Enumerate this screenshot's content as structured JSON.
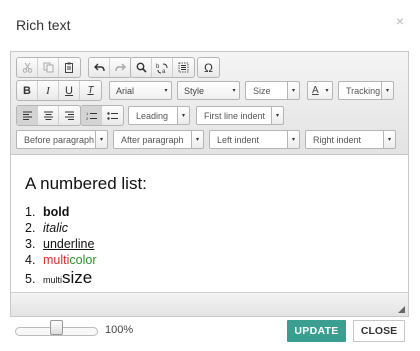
{
  "dialog": {
    "title": "Rich text",
    "close_glyph": "×"
  },
  "toolbar": {
    "font": "Arial",
    "style": "Style",
    "size": "Size",
    "font_color_glyph": "A",
    "tracking": "Tracking",
    "leading": "Leading",
    "first_line_indent": "First line indent",
    "before_paragraph": "Before paragraph",
    "after_paragraph": "After paragraph",
    "left_indent": "Left indent",
    "right_indent": "Right indent",
    "bold_glyph": "B",
    "italic_glyph": "I",
    "underline_glyph": "U",
    "clear_glyph": "T",
    "omega_glyph": "Ω",
    "arrow_glyph": "▾"
  },
  "content": {
    "heading": "A numbered list:",
    "items": [
      {
        "num": "1.",
        "text": "bold"
      },
      {
        "num": "2.",
        "text": "italic"
      },
      {
        "num": "3.",
        "text": "underline"
      },
      {
        "num": "4.",
        "part_red": "multi",
        "part_green": "color"
      },
      {
        "num": "5.",
        "part_small": "multi",
        "part_large": "size"
      }
    ]
  },
  "footer": {
    "zoom_label": "100%",
    "zoom_level": 0.5,
    "update_label": "UPDATE",
    "close_label": "CLOSE"
  },
  "colors": {
    "accent": "#3a9e91",
    "red_text": "#d32f2f",
    "green_text": "#2e8b2e"
  }
}
